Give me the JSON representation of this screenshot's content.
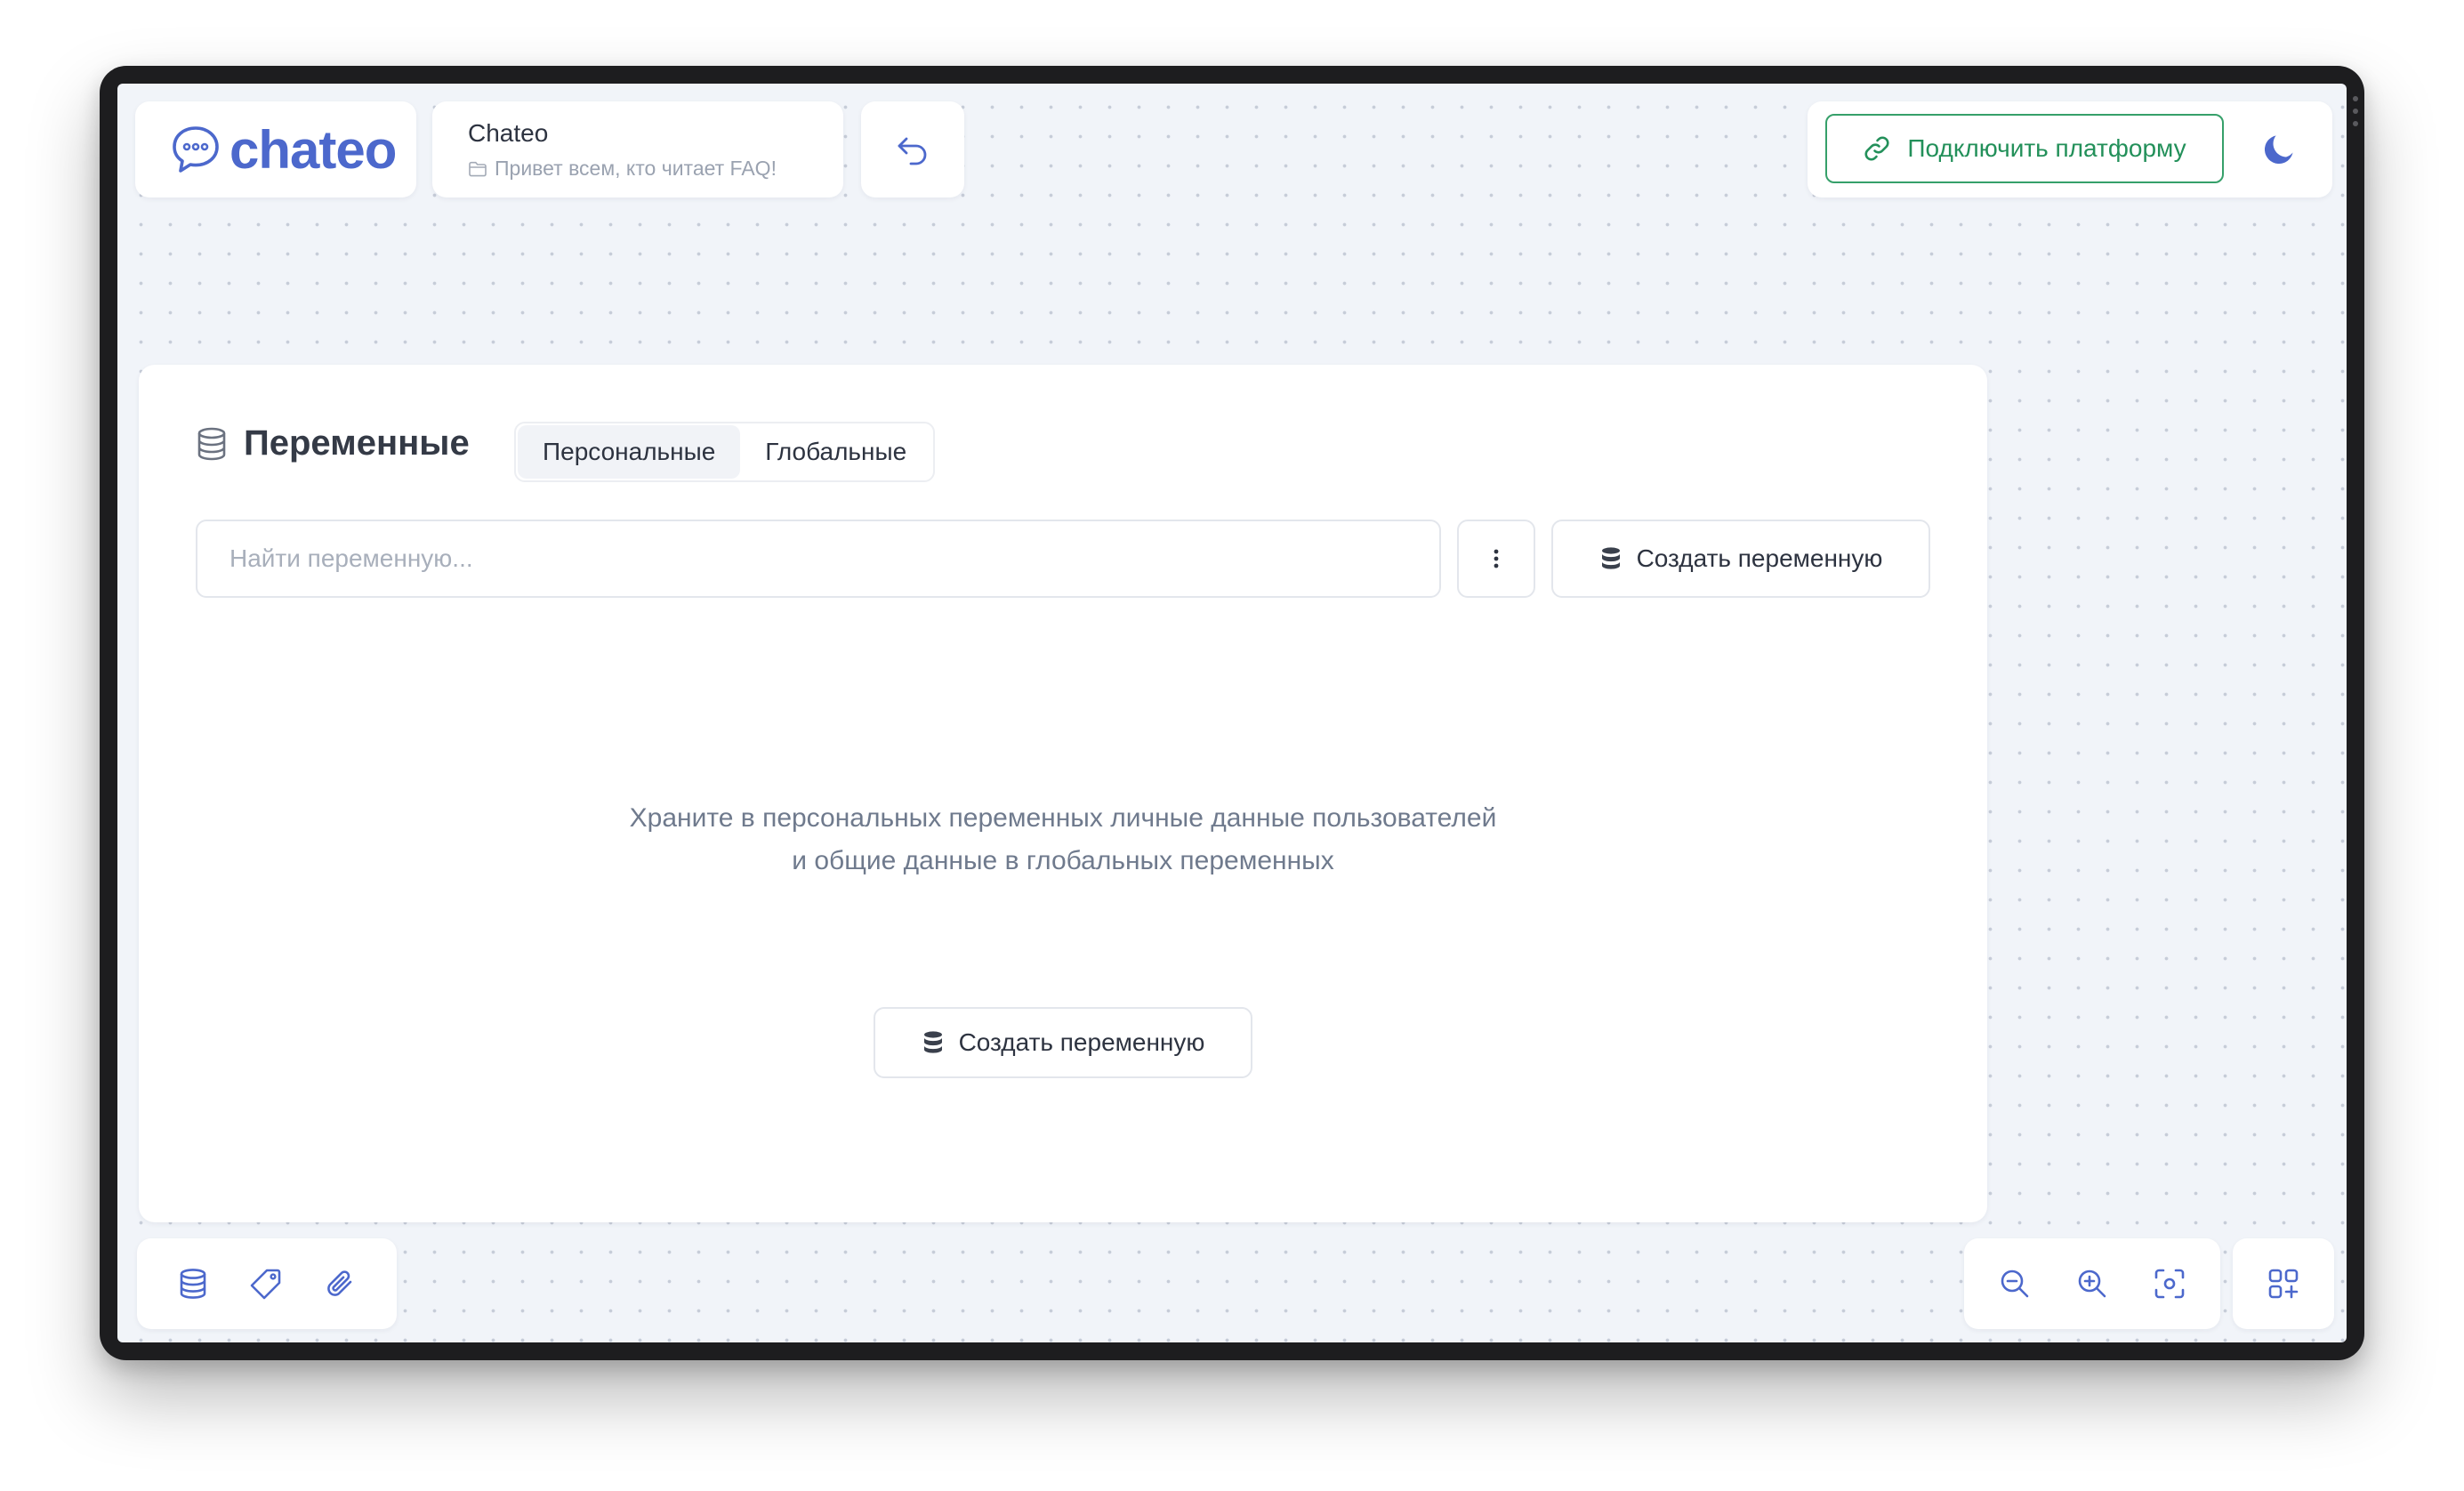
{
  "header": {
    "logo_text": "chateo",
    "project_name": "Chateo",
    "project_subtitle": "Привет всем, кто читает FAQ!",
    "connect_label": "Подключить платформу"
  },
  "variables": {
    "title": "Переменные",
    "tabs": [
      {
        "label": "Персональные",
        "active": true
      },
      {
        "label": "Глобальные",
        "active": false
      }
    ],
    "search_placeholder": "Найти переменную...",
    "create_label": "Создать переменную",
    "empty_line1": "Храните в персональных переменных личные данные пользователей",
    "empty_line2": "и общие данные в глобальных переменных",
    "empty_create_label": "Создать переменную"
  },
  "icons": {
    "logo": "chat-bubble-icon",
    "project": "folder-icon",
    "back": "undo-icon",
    "connect": "link-icon",
    "theme": "moon-icon",
    "variables": "database-icon",
    "more": "kebab-icon",
    "toolbar_left": [
      "database-icon",
      "tag-icon",
      "paperclip-icon"
    ],
    "toolbar_zoom": [
      "zoom-out-icon",
      "zoom-in-icon",
      "focus-icon"
    ],
    "toolbar_apps": "apps-add-icon"
  },
  "colors": {
    "brand_blue": "#4c68cc",
    "connect_green": "#23905a",
    "canvas_bg": "#f1f4f9",
    "text_muted": "#6f7a8d"
  }
}
